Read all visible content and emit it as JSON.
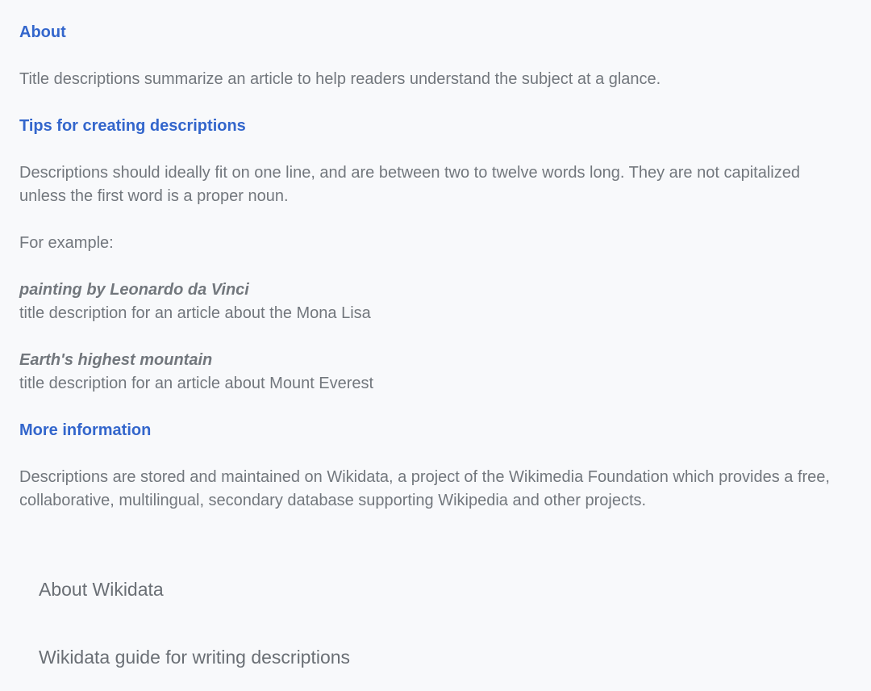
{
  "about": {
    "heading": "About",
    "text": "Title descriptions summarize an article to help readers understand the subject at a glance."
  },
  "tips": {
    "heading": "Tips for creating descriptions",
    "text": "Descriptions should ideally fit on one line, and are between two to twelve words long. They are not capitalized unless the first word is a proper noun.",
    "for_example": "For example:",
    "examples": [
      {
        "title": "painting by Leonardo da Vinci",
        "caption": "title description for an article about the Mona Lisa"
      },
      {
        "title": "Earth's highest mountain",
        "caption": "title description for an article about Mount Everest"
      }
    ]
  },
  "more_info": {
    "heading": "More information",
    "text": "Descriptions are stored and maintained on Wikidata, a project of the Wikimedia Foundation which provides a free, collaborative, multilingual, secondary database supporting Wikipedia and other projects."
  },
  "links": [
    {
      "label": "About Wikidata"
    },
    {
      "label": "Wikidata guide for writing descriptions"
    }
  ],
  "colors": {
    "accent": "#3366cc",
    "text": "#72777d",
    "background": "#f8f9fb"
  }
}
